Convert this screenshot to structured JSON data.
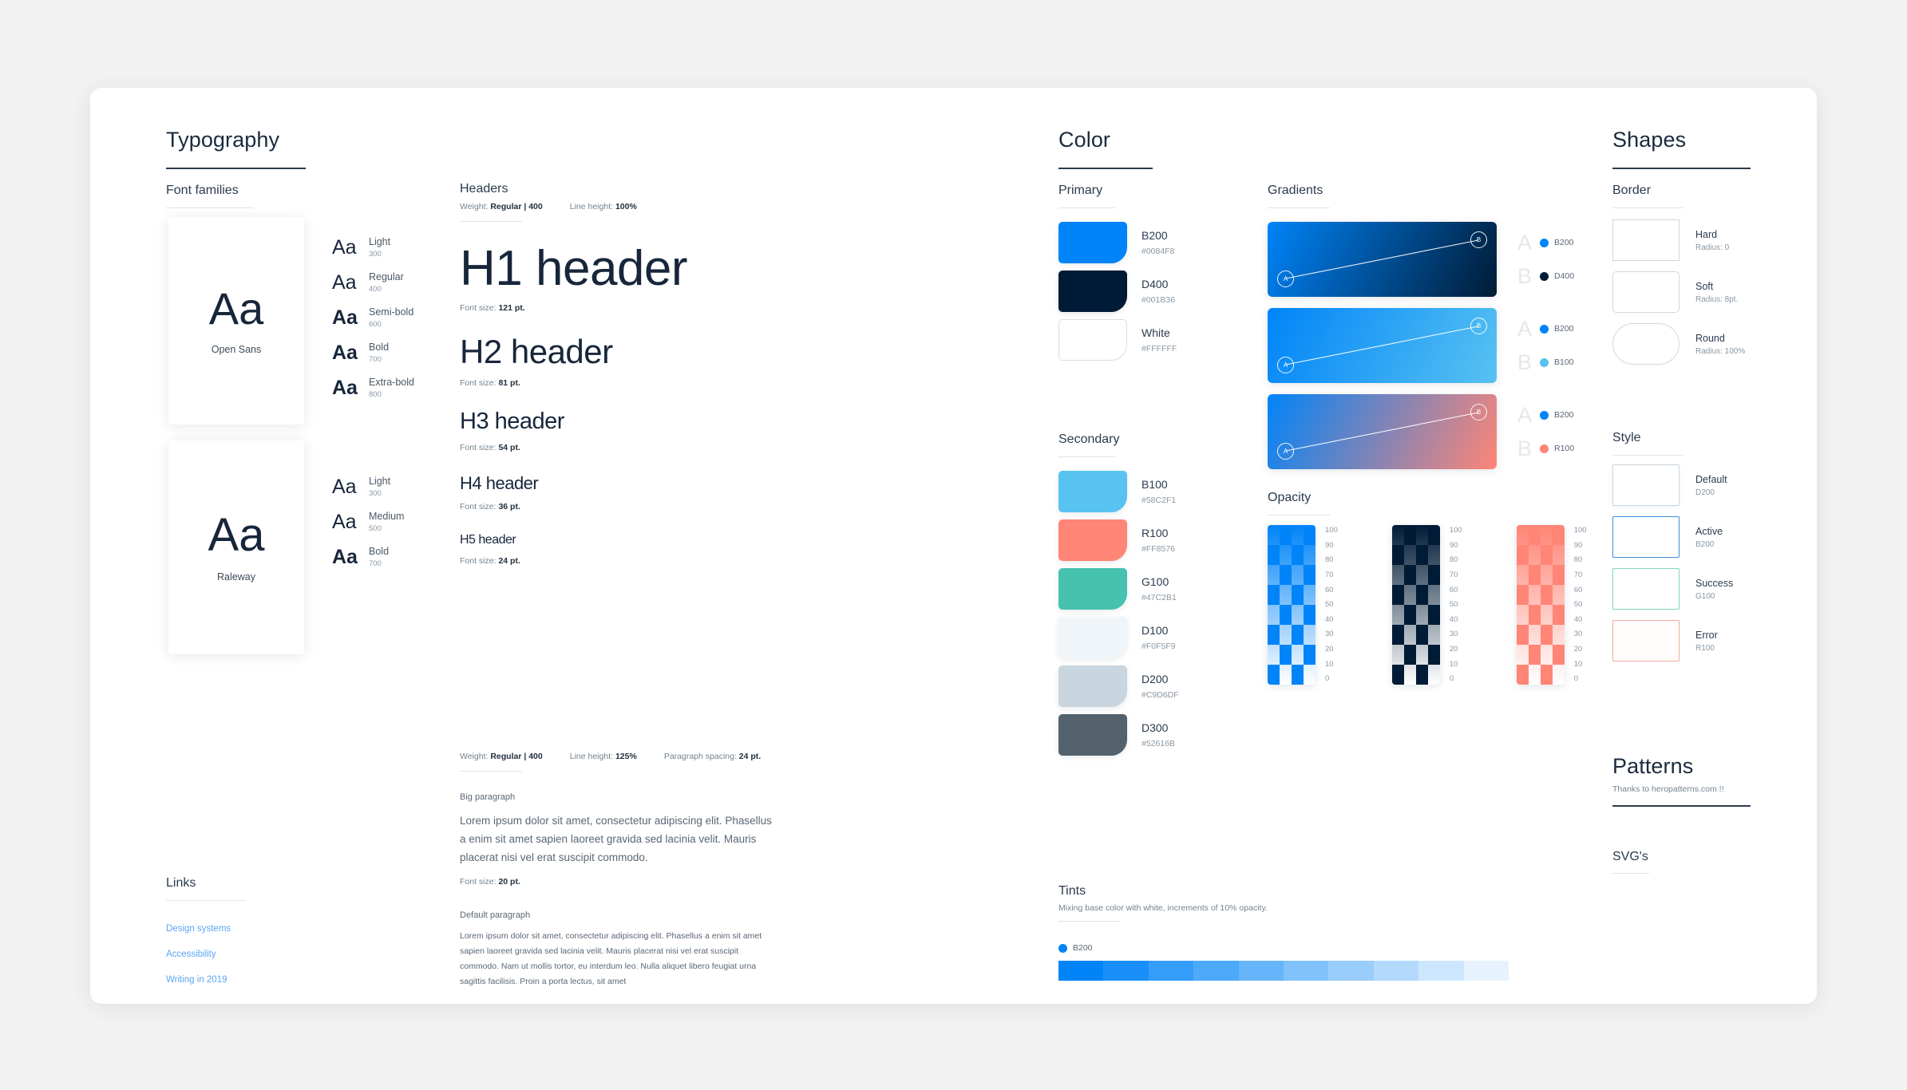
{
  "typography": {
    "title": "Typography",
    "font_families": {
      "title": "Font families",
      "cards": [
        {
          "glyph": "Aa",
          "name": "Open Sans"
        },
        {
          "glyph": "Aa",
          "name": "Raleway"
        }
      ],
      "open_sans_weights": [
        {
          "glyph": "Aa",
          "label": "Light",
          "num": "300"
        },
        {
          "glyph": "Aa",
          "label": "Regular",
          "num": "400"
        },
        {
          "glyph": "Aa",
          "label": "Semi-bold",
          "num": "600"
        },
        {
          "glyph": "Aa",
          "label": "Bold",
          "num": "700"
        },
        {
          "glyph": "Aa",
          "label": "Extra-bold",
          "num": "800"
        }
      ],
      "raleway_weights": [
        {
          "glyph": "Aa",
          "label": "Light",
          "num": "300"
        },
        {
          "glyph": "Aa",
          "label": "Medium",
          "num": "500"
        },
        {
          "glyph": "Aa",
          "label": "Bold",
          "num": "700"
        }
      ]
    },
    "links": {
      "title": "Links",
      "items": [
        "Design systems",
        "Accessibility",
        "Writing in 2019"
      ],
      "color": "#5AA6F2"
    },
    "headers": {
      "title": "Headers",
      "weight_label": "Weight:",
      "weight_value": "Regular | 400",
      "line_height_label": "Line height:",
      "line_height_value": "100%",
      "size_label": "Font size:",
      "samples": [
        {
          "text": "H1 header",
          "size": "121 pt."
        },
        {
          "text": "H2 header",
          "size": "81 pt."
        },
        {
          "text": "H3 header",
          "size": "54 pt."
        },
        {
          "text": "H4 header",
          "size": "36 pt."
        },
        {
          "text": "H5 header",
          "size": "24 pt."
        }
      ]
    },
    "paragraphs": {
      "weight_label": "Weight:",
      "weight_value": "Regular | 400",
      "line_height_label": "Line height:",
      "line_height_value": "125%",
      "spacing_label": "Paragraph spacing:",
      "spacing_value": "24 pt.",
      "big_label": "Big paragraph",
      "big_text": "Lorem ipsum dolor sit amet, consectetur adipiscing elit. Phasellus a enim sit amet sapien laoreet gravida sed lacinia velit. Mauris placerat nisi vel erat suscipit commodo.",
      "big_size_label": "Font size:",
      "big_size_value": "20 pt.",
      "default_label": "Default paragraph",
      "default_text": "Lorem ipsum dolor sit amet, consectetur adipiscing elit. Phasellus a enim sit amet sapien laoreet gravida sed lacinia velit. Mauris placerat nisi vel erat suscipit commodo. Nam ut mollis tortor, eu interdum leo. Nulla aliquet libero feugiat urna sagittis facilisis. Proin a porta lectus, sit amet"
    }
  },
  "color": {
    "title": "Color",
    "primary": {
      "title": "Primary",
      "swatches": [
        {
          "name": "B200",
          "hex": "#0084F8"
        },
        {
          "name": "D400",
          "hex": "#001B36"
        },
        {
          "name": "White",
          "hex": "#FFFFFF"
        }
      ]
    },
    "secondary": {
      "title": "Secondary",
      "swatches": [
        {
          "name": "B100",
          "hex": "#58C2F1"
        },
        {
          "name": "R100",
          "hex": "#FF8576"
        },
        {
          "name": "G100",
          "hex": "#47C2B1"
        },
        {
          "name": "D100",
          "hex": "#F0F5F9"
        },
        {
          "name": "D200",
          "hex": "#C9D6DF"
        },
        {
          "name": "D300",
          "hex": "#52616B"
        }
      ]
    },
    "gradients": {
      "title": "Gradients",
      "items": [
        {
          "handle_a": "A",
          "handle_b": "B",
          "stops": [
            {
              "letter": "A",
              "name": "B200",
              "hex": "#0084F8"
            },
            {
              "letter": "B",
              "name": "D400",
              "hex": "#001B36"
            }
          ]
        },
        {
          "handle_a": "A",
          "handle_b": "B",
          "stops": [
            {
              "letter": "A",
              "name": "B200",
              "hex": "#0084F8"
            },
            {
              "letter": "B",
              "name": "B100",
              "hex": "#58C2F1"
            }
          ]
        },
        {
          "handle_a": "A",
          "handle_b": "B",
          "stops": [
            {
              "letter": "A",
              "name": "B200",
              "hex": "#0084F8"
            },
            {
              "letter": "B",
              "name": "R100",
              "hex": "#FF8576"
            }
          ]
        }
      ]
    },
    "opacity": {
      "title": "Opacity",
      "ticks": [
        "100",
        "90",
        "80",
        "70",
        "60",
        "50",
        "40",
        "30",
        "20",
        "10",
        "0"
      ],
      "groups": [
        {
          "base_hex": "#0084F8"
        },
        {
          "base_hex": "#001B36"
        },
        {
          "base_hex": "#FF8576"
        }
      ]
    },
    "tints": {
      "title": "Tints",
      "subtitle": "Mixing base color with white, increments of 10% opacity.",
      "base_name": "B200",
      "base_hex": "#0084F8",
      "steps": [
        "100",
        "90",
        "80",
        "70",
        "60",
        "50",
        "40",
        "30",
        "20",
        "10"
      ]
    }
  },
  "shapes": {
    "title": "Shapes",
    "border": {
      "title": "Border",
      "items": [
        {
          "name": "Hard",
          "meta": "Radius: 0",
          "radius": "0px"
        },
        {
          "name": "Soft",
          "meta": "Radius: 8pt.",
          "radius": "5px"
        },
        {
          "name": "Round",
          "meta": "Radius: 100%",
          "radius": "26px"
        }
      ]
    },
    "style": {
      "title": "Style",
      "items": [
        {
          "name": "Default",
          "meta": "D200",
          "border_hex": "#C9D6DF",
          "fill_hex": "#FFFFFF"
        },
        {
          "name": "Active",
          "meta": "B200",
          "border_hex": "#3C8FD9",
          "fill_hex": "#FFFFFF"
        },
        {
          "name": "Success",
          "meta": "G100",
          "border_hex": "#7FD4C4",
          "fill_hex": "#FFFFFF"
        },
        {
          "name": "Error",
          "meta": "R100",
          "border_hex": "#F6A99C",
          "fill_hex": "#FFFCFB"
        }
      ]
    },
    "patterns": {
      "title": "Patterns",
      "subtitle": "Thanks to heropatterns.com !!"
    },
    "svgs": {
      "title": "SVG's"
    }
  }
}
